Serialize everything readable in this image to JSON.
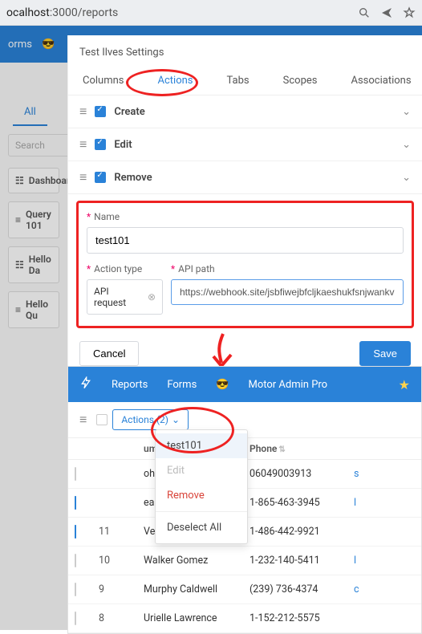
{
  "browser": {
    "url_pre": "ocalhost",
    "url_port": ":3000",
    "url_path": "/reports"
  },
  "behind": {
    "forms": "orms",
    "tab_all": "All",
    "search_placeholder": "Search",
    "buttons": [
      "Dashboard",
      "Query 101",
      "Hello Da",
      "Hello Qu"
    ]
  },
  "modal": {
    "title": "Test Ilves Settings",
    "tabs": [
      "Columns",
      "Actions",
      "Tabs",
      "Scopes",
      "Associations"
    ],
    "active_tab": 1,
    "actions": [
      "Create",
      "Edit",
      "Remove"
    ],
    "name_label": "Name",
    "name_value": "test101",
    "action_type_label": "Action type",
    "action_type_value": "API request",
    "api_path_label": "API path",
    "api_path_value": "https://webhook.site/jsbfiwejbfcljkaeshukfsnjwankv",
    "cancel": "Cancel",
    "save": "Save"
  },
  "page2": {
    "nav": {
      "reports": "Reports",
      "forms": "Forms",
      "pro": "Motor Admin Pro"
    },
    "actions_btn": "Actions (2)",
    "dropdown": {
      "i0": "test101",
      "i1": "Edit",
      "i2": "Remove",
      "i3": "Deselect All"
    },
    "headers": {
      "name_suffix": "ume",
      "phone": "Phone"
    },
    "rows": [
      {
        "checked": false,
        "id": "",
        "name": "ohammad Suleman",
        "phone": "06049003913",
        "link": "s"
      },
      {
        "checked": true,
        "id": "",
        "name": "eanna Carney",
        "phone": "1-865-463-3945",
        "link": "l"
      },
      {
        "checked": true,
        "id": "11",
        "name": "Vera Horn",
        "phone": "1-486-442-9921",
        "link": ""
      },
      {
        "checked": false,
        "id": "10",
        "name": "Walker Gomez",
        "phone": "1-232-140-5411",
        "link": "l"
      },
      {
        "checked": false,
        "id": "9",
        "name": "Murphy Caldwell",
        "phone": "(239) 736-4374",
        "link": "c"
      },
      {
        "checked": false,
        "id": "8",
        "name": "Urielle Lawrence",
        "phone": "1-152-212-5575",
        "link": ""
      }
    ]
  }
}
